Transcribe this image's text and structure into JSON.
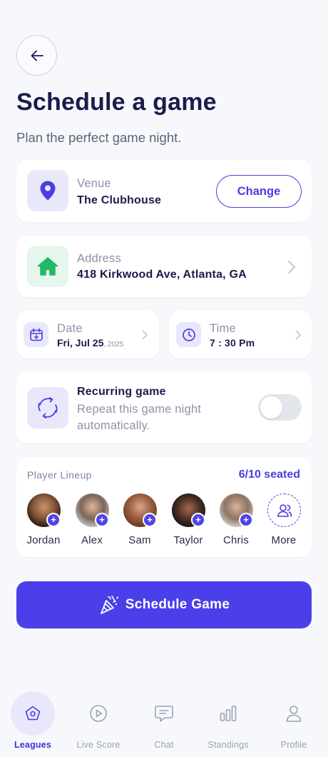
{
  "header": {
    "title": "Schedule a game",
    "subtitle": "Plan the perfect game night."
  },
  "venue": {
    "label": "Venue",
    "value": "The Clubhouse",
    "change_label": "Change"
  },
  "address": {
    "label": "Address",
    "value": "418 Kirkwood Ave, Atlanta, GA"
  },
  "date": {
    "label": "Date",
    "value": "Fri, Jul 25",
    "year": ", 2025"
  },
  "time": {
    "label": "Time",
    "value": "7 : 30 Pm"
  },
  "recurring": {
    "title": "Recurring game",
    "description_line1": "Repeat this game night",
    "description_line2": "automatically.",
    "enabled": false
  },
  "lineup": {
    "title": "Player Lineup",
    "seated": "6/10 seated",
    "players": [
      {
        "name": "Jordan"
      },
      {
        "name": "Alex"
      },
      {
        "name": "Sam"
      },
      {
        "name": "Taylor"
      },
      {
        "name": "Chris"
      }
    ],
    "more_label": "More"
  },
  "cta": {
    "label": "Schedule Game"
  },
  "nav": {
    "items": [
      {
        "label": "Leagues",
        "icon": "pentagon-icon",
        "active": true
      },
      {
        "label": "Live Score",
        "icon": "play-circle-icon",
        "active": false
      },
      {
        "label": "Chat",
        "icon": "chat-bubble-icon",
        "active": false
      },
      {
        "label": "Standings",
        "icon": "bar-chart-icon",
        "active": false
      },
      {
        "label": "Profile",
        "icon": "user-icon",
        "active": false
      }
    ]
  },
  "colors": {
    "accent": "#4a3fe8",
    "title": "#1d1b4b",
    "muted": "#8c93a8",
    "green": "#22b866"
  }
}
